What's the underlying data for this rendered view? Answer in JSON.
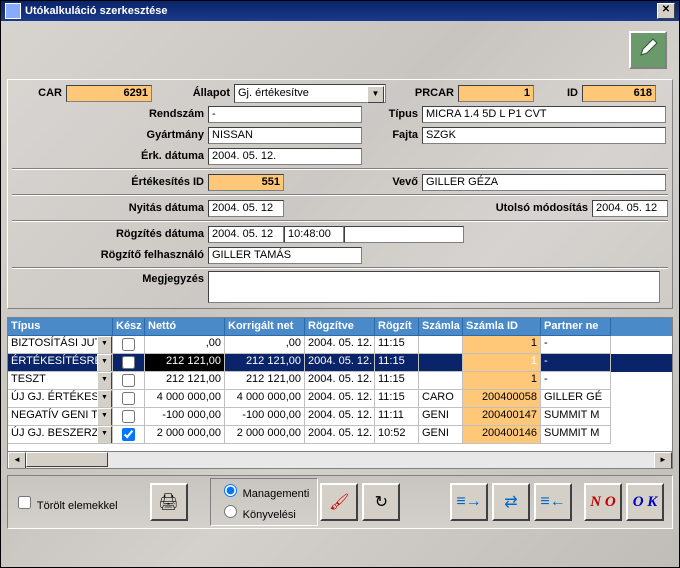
{
  "window": {
    "title": "Utókalkuláció szerkesztése"
  },
  "hdr": {
    "car_label": "CAR",
    "car": "6291",
    "allapot_label": "Állapot",
    "allapot": "Gj. értékesítve",
    "prcar_label": "PRCAR",
    "prcar": "1",
    "id_label": "ID",
    "id": "618",
    "rendszam_label": "Rendszám",
    "rendszam": "-",
    "tipus_label": "Típus",
    "tipus": "MICRA 1.4 5D L P1 CVT",
    "gyartmany_label": "Gyártmány",
    "gyartmany": "NISSAN",
    "fajta_label": "Fajta",
    "fajta": "SZGK",
    "erkdat_label": "Érk. dátuma",
    "erkdat": "2004. 05. 12.",
    "ertid_label": "Értékesítés ID",
    "ertid": "551",
    "vevo_label": "Vevő",
    "vevo": "GILLER GÉZA",
    "nyitas_label": "Nyitás dátuma",
    "nyitas": "2004. 05. 12",
    "utolso_label": "Utolsó módosítás",
    "utolso": "2004. 05. 12",
    "rogzdat_label": "Rögzítés dátuma",
    "rogzdat": "2004. 05. 12",
    "rogzido": "10:48:00",
    "rogzfelh_label": "Rögzítő felhasználó",
    "rogzfelh": "GILLER TAMÁS",
    "megj_label": "Megjegyzés",
    "megj": ""
  },
  "grid": {
    "cols": [
      "Típus",
      "Kész",
      "Nettó",
      "Korrigált net",
      "Rögzítve",
      "Rögzít",
      "Számla",
      "Számla ID",
      "Partner ne"
    ],
    "rows": [
      {
        "tipus": "BIZTOSÍTÁSI JUTA",
        "kesz": false,
        "netto": ",00",
        "korr": ",00",
        "rogd": "2004. 05. 12.",
        "rogi": "11:15",
        "szamla": "",
        "szid": "1",
        "partner": "-",
        "sel": false,
        "blk": false
      },
      {
        "tipus": "ÉRTÉKESÍTÉSRE",
        "kesz": false,
        "netto": "212 121,00",
        "korr": "212 121,00",
        "rogd": "2004. 05. 12.",
        "rogi": "11:15",
        "szamla": "",
        "szid": "1",
        "partner": "-",
        "sel": true,
        "blk": true
      },
      {
        "tipus": "TESZT",
        "kesz": false,
        "netto": "212 121,00",
        "korr": "212 121,00",
        "rogd": "2004. 05. 12.",
        "rogi": "11:15",
        "szamla": "",
        "szid": "1",
        "partner": "-",
        "sel": false,
        "blk": false
      },
      {
        "tipus": "ÚJ GJ. ÉRTÉKES",
        "kesz": false,
        "netto": "4 000 000,00",
        "korr": "4 000 000,00",
        "rogd": "2004. 05. 12.",
        "rogi": "11:15",
        "szamla": "CARO",
        "szid": "200400058",
        "partner": "GILLER GÉ",
        "sel": false,
        "blk": false
      },
      {
        "tipus": "NEGATÍV GENI TE",
        "kesz": false,
        "netto": "-100 000,00",
        "korr": "-100 000,00",
        "rogd": "2004. 05. 12.",
        "rogi": "11:11",
        "szamla": "GENI",
        "szid": "200400147",
        "partner": "SUMMIT M",
        "sel": false,
        "blk": false
      },
      {
        "tipus": "ÚJ GJ. BESZERZ",
        "kesz": true,
        "netto": "2 000 000,00",
        "korr": "2 000 000,00",
        "rogd": "2004. 05. 12.",
        "rogi": "10:52",
        "szamla": "GENI",
        "szid": "200400146",
        "partner": "SUMMIT M",
        "sel": false,
        "blk": false
      }
    ]
  },
  "footer": {
    "torolt": "Törölt elemekkel",
    "r1": "Managementi",
    "r2": "Könyvelési",
    "no": "N O",
    "ok": "O K"
  }
}
